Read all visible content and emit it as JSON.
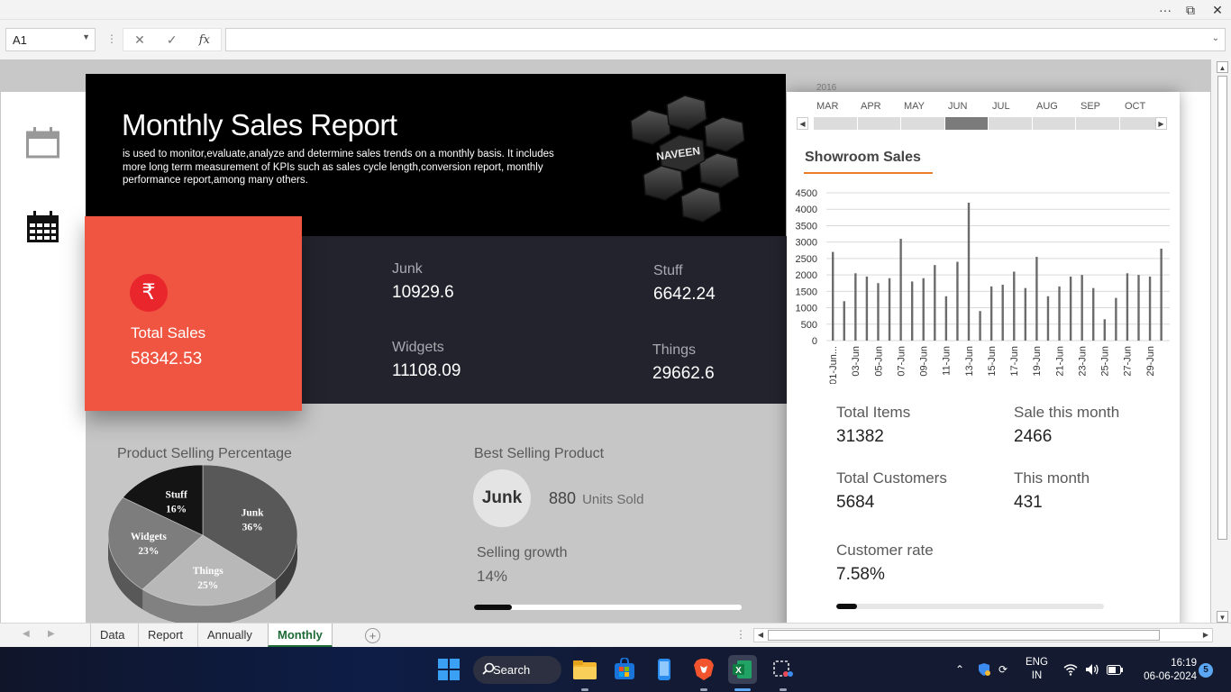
{
  "window": {
    "controls": [
      "···",
      "⧉",
      "✕"
    ]
  },
  "formula_bar": {
    "name_box": "A1",
    "formula": ""
  },
  "dashboard": {
    "title": "Monthly Sales Report",
    "description": "is used to monitor,evaluate,analyze and determine sales trends on a monthly basis. It includes more long term measurement of KPIs such as sales cycle length,conversion report, monthly performance report,among many others.",
    "logo_text": "NAVEEN",
    "total_sales": {
      "label": "Total Sales",
      "value": "58342.53",
      "icon": "rupee-icon"
    },
    "products": [
      {
        "label": "Junk",
        "value": "10929.6"
      },
      {
        "label": "Stuff",
        "value": "6642.24"
      },
      {
        "label": "Widgets",
        "value": "11108.09"
      },
      {
        "label": "Things",
        "value": "29662.6"
      }
    ],
    "pie_title": "Product Selling Percentage",
    "pie_labels": [
      {
        "name": "Stuff",
        "pct": "16%"
      },
      {
        "name": "Junk",
        "pct": "36%"
      },
      {
        "name": "Widgets",
        "pct": "23%"
      },
      {
        "name": "Things",
        "pct": "25%"
      }
    ],
    "best_selling": {
      "title": "Best Selling Product",
      "product": "Junk",
      "units": "880",
      "units_label": "Units Sold"
    },
    "growth": {
      "label": "Selling growth",
      "value": "14%",
      "fraction": 0.14
    },
    "right": {
      "year": "2016",
      "months": [
        "MAR",
        "APR",
        "MAY",
        "JUN",
        "JUL",
        "AUG",
        "SEP",
        "OCT"
      ],
      "selected_month": "JUN",
      "chart_title": "Showroom Sales",
      "stats": [
        {
          "label": "Total Items",
          "value": "31382"
        },
        {
          "label": "Sale this month",
          "value": "2466"
        },
        {
          "label": "Total Customers",
          "value": "5684"
        },
        {
          "label": "This month",
          "value": "431"
        },
        {
          "label": "Customer rate",
          "value": "7.58%"
        }
      ],
      "customer_rate_fraction": 0.0758
    }
  },
  "chart_data": [
    {
      "type": "pie",
      "title": "Product Selling Percentage",
      "categories": [
        "Junk",
        "Things",
        "Widgets",
        "Stuff"
      ],
      "values": [
        36,
        25,
        23,
        16
      ],
      "colors": [
        "#585858",
        "#b8b8b8",
        "#7d7d7d",
        "#141414"
      ]
    },
    {
      "type": "bar",
      "title": "Showroom Sales",
      "x_tick_labels": [
        "01-Jun...",
        "03-Jun",
        "05-Jun",
        "07-Jun",
        "09-Jun",
        "11-Jun",
        "13-Jun",
        "15-Jun",
        "17-Jun",
        "19-Jun",
        "21-Jun",
        "23-Jun",
        "25-Jun",
        "27-Jun",
        "29-Jun"
      ],
      "values": [
        2700,
        1200,
        2050,
        1950,
        1750,
        1900,
        3100,
        1800,
        1900,
        2300,
        1350,
        2400,
        4200,
        900,
        1650,
        1700,
        2100,
        1600,
        2550,
        1350,
        1650,
        1950,
        2000,
        1600,
        650,
        1300,
        2050,
        2000,
        1950,
        2800
      ],
      "y_ticks": [
        0,
        500,
        1000,
        1500,
        2000,
        2500,
        3000,
        3500,
        4000,
        4500
      ],
      "ylim": [
        0,
        4500
      ],
      "grid": true,
      "bar_color": "#6b6b6b"
    }
  ],
  "sheet_tabs": [
    "Data",
    "Report",
    "Annually",
    "Monthly"
  ],
  "active_tab": "Monthly",
  "taskbar": {
    "search_label": "Search",
    "lang": "ENG",
    "region": "IN",
    "time": "16:19",
    "date": "06-06-2024",
    "notifications": "5"
  }
}
